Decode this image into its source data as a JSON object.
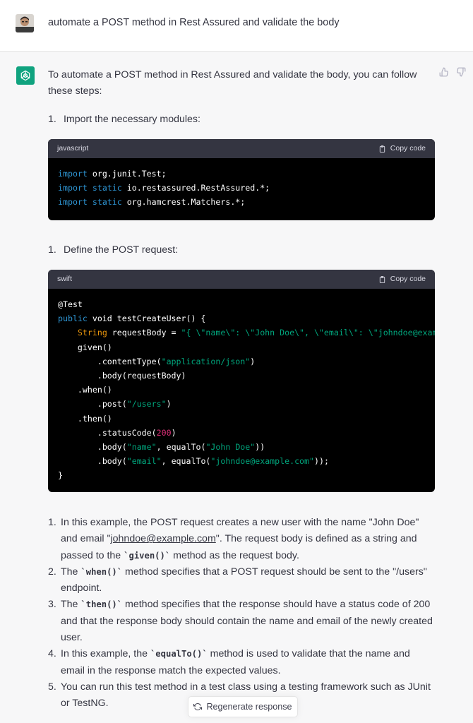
{
  "user": {
    "prompt": "automate a POST method in Rest Assured and validate the body"
  },
  "assistant": {
    "intro": "To automate a POST method in Rest Assured and validate the body, you can follow these steps:",
    "steps": [
      {
        "num": "1.",
        "label": "Import the necessary modules:"
      },
      {
        "num": "1.",
        "label": "Define the POST request:"
      }
    ],
    "code_blocks": [
      {
        "language": "javascript",
        "copy_label": "Copy code",
        "lines": [
          [
            {
              "t": "import",
              "c": "kw"
            },
            {
              "t": " org.junit.Test;",
              "c": ""
            }
          ],
          [
            {
              "t": "import",
              "c": "kw"
            },
            {
              "t": " ",
              "c": ""
            },
            {
              "t": "static",
              "c": "kw"
            },
            {
              "t": " io.restassured.RestAssured.*;",
              "c": ""
            }
          ],
          [
            {
              "t": "import",
              "c": "kw"
            },
            {
              "t": " ",
              "c": ""
            },
            {
              "t": "static",
              "c": "kw"
            },
            {
              "t": " org.hamcrest.Matchers.*;",
              "c": ""
            }
          ]
        ]
      },
      {
        "language": "swift",
        "copy_label": "Copy code",
        "lines": [
          [
            {
              "t": "@Test",
              "c": "an"
            }
          ],
          [
            {
              "t": "public",
              "c": "kw"
            },
            {
              "t": " void testCreateUser() {",
              "c": ""
            }
          ],
          [
            {
              "t": "    ",
              "c": ""
            },
            {
              "t": "String",
              "c": "ty"
            },
            {
              "t": " requestBody = ",
              "c": ""
            },
            {
              "t": "\"{ \\\"name\\\": \\\"John Doe\\\", \\\"email\\\": \\\"johndoe@example.com\\\" }\";",
              "c": "st"
            }
          ],
          [
            {
              "t": "    given()",
              "c": ""
            }
          ],
          [
            {
              "t": "        .contentType(",
              "c": ""
            },
            {
              "t": "\"application/json\"",
              "c": "st"
            },
            {
              "t": ")",
              "c": ""
            }
          ],
          [
            {
              "t": "        .body(requestBody)",
              "c": ""
            }
          ],
          [
            {
              "t": "    .when()",
              "c": ""
            }
          ],
          [
            {
              "t": "        .post(",
              "c": ""
            },
            {
              "t": "\"/users\"",
              "c": "st"
            },
            {
              "t": ")",
              "c": ""
            }
          ],
          [
            {
              "t": "    .then()",
              "c": ""
            }
          ],
          [
            {
              "t": "        .statusCode(",
              "c": ""
            },
            {
              "t": "200",
              "c": "nu"
            },
            {
              "t": ")",
              "c": ""
            }
          ],
          [
            {
              "t": "        .body(",
              "c": ""
            },
            {
              "t": "\"name\"",
              "c": "st"
            },
            {
              "t": ", equalTo(",
              "c": ""
            },
            {
              "t": "\"John Doe\"",
              "c": "st"
            },
            {
              "t": "))",
              "c": ""
            }
          ],
          [
            {
              "t": "        .body(",
              "c": ""
            },
            {
              "t": "\"email\"",
              "c": "st"
            },
            {
              "t": ", equalTo(",
              "c": ""
            },
            {
              "t": "\"johndoe@example.com\"",
              "c": "st"
            },
            {
              "t": "));",
              "c": ""
            }
          ],
          [
            {
              "t": "}",
              "c": ""
            }
          ]
        ]
      }
    ],
    "notes": [
      {
        "num": "1.",
        "parts": [
          {
            "t": "In this example, the POST request creates a new user with the name \"John Doe\" and email \"",
            "k": "text"
          },
          {
            "t": "johndoe@example.com",
            "k": "link"
          },
          {
            "t": "\". The request body is defined as a string and passed to the ",
            "k": "text"
          },
          {
            "t": "`given()`",
            "k": "code"
          },
          {
            "t": " method as the request body.",
            "k": "text"
          }
        ]
      },
      {
        "num": "2.",
        "parts": [
          {
            "t": "The ",
            "k": "text"
          },
          {
            "t": "`when()`",
            "k": "code"
          },
          {
            "t": " method specifies that a POST request should be sent to the \"/users\" endpoint.",
            "k": "text"
          }
        ]
      },
      {
        "num": "3.",
        "parts": [
          {
            "t": "The ",
            "k": "text"
          },
          {
            "t": "`then()`",
            "k": "code"
          },
          {
            "t": " method specifies that the response should have a status code of 200 and that the response body should contain the name and email of the newly created user.",
            "k": "text"
          }
        ]
      },
      {
        "num": "4.",
        "parts": [
          {
            "t": "In this example, the ",
            "k": "text"
          },
          {
            "t": "`equalTo()`",
            "k": "code"
          },
          {
            "t": " method is used to validate that the name and email in the response match the expected values.",
            "k": "text"
          }
        ]
      },
      {
        "num": "5.",
        "parts": [
          {
            "t": "You can run this test method in a test class using a testing framework such as JUnit or TestNG.",
            "k": "text"
          }
        ]
      }
    ]
  },
  "footer": {
    "regenerate_label": "Regenerate response"
  },
  "colors": {
    "accent": "#10a37f",
    "code_bg": "#000000",
    "code_header": "#343541"
  },
  "icons": {
    "user_avatar": "user-avatar",
    "bot_avatar": "openai-logo-icon",
    "thumbs_up": "thumbs-up-icon",
    "thumbs_down": "thumbs-down-icon",
    "clipboard": "clipboard-icon",
    "regenerate": "refresh-icon"
  }
}
